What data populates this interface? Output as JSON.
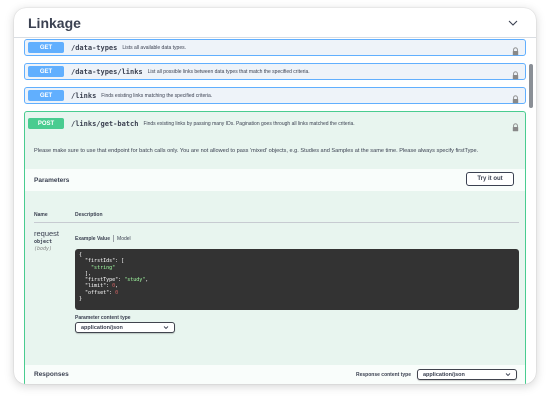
{
  "section": {
    "title": "Linkage"
  },
  "endpoints": [
    {
      "method": "GET",
      "path": "/data-types",
      "description": "Lists all available data types."
    },
    {
      "method": "GET",
      "path": "/data-types/links",
      "description": "List all possible links between data types that match the specified criteria."
    },
    {
      "method": "GET",
      "path": "/links",
      "description": "Finds existing links matching the specified criteria."
    },
    {
      "method": "POST",
      "path": "/links/get-batch",
      "description": "Finds existing links by passing many IDs. Pagination goes through all links matched the criteria."
    }
  ],
  "post_detail": {
    "note": "Please make sure to use that endpoint for batch calls only. You are not allowed to pass 'mixed' objects, e.g. Studies and Samples at the same time. Please always specify firstType.",
    "parameters_title": "Parameters",
    "try_it_out_label": "Try it out",
    "columns": {
      "name": "Name",
      "description": "Description"
    },
    "param": {
      "name": "request",
      "type": "object",
      "in": "(body)"
    },
    "tabs": {
      "example": "Example Value",
      "model": "Model"
    },
    "example_json": {
      "open": "{",
      "firstIds_key": "\"firstIds\"",
      "firstIds_open": ": [",
      "firstIds_item": "\"string\"",
      "firstIds_close": "],",
      "firstType_key": "\"firstType\"",
      "firstType_value": "\"study\"",
      "limit_key": "\"limit\"",
      "limit_value": "0",
      "offset_key": "\"offset\"",
      "offset_value": "0",
      "close": "}"
    },
    "parameter_content_type_label": "Parameter content type",
    "parameter_content_type_value": "application/json"
  },
  "responses": {
    "title": "Responses",
    "content_type_label": "Response content type",
    "content_type_value": "application/json"
  },
  "colors": {
    "get": "#61affe",
    "post": "#49cc90",
    "text": "#3b4151",
    "code_bg": "#333333"
  },
  "icons": {
    "section_toggle": "chevron-down-icon",
    "auth": "lock-icon",
    "select": "caret-down-icon"
  }
}
